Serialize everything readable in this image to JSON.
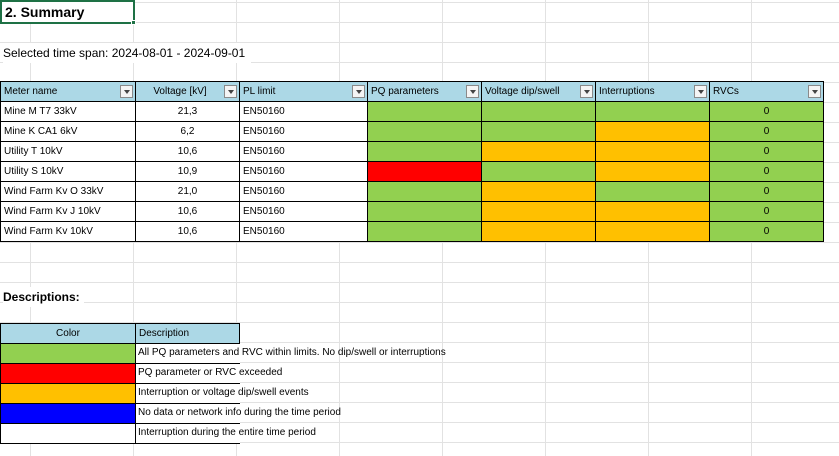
{
  "sheet": {
    "title": "2. Summary",
    "time_span": "Selected time span: 2024-08-01 - 2024-09-01",
    "descriptions_title": "Descriptions:"
  },
  "colors": {
    "green": "#92d050",
    "red": "#ff0000",
    "orange": "#ffc000",
    "blue": "#0000ff",
    "white": "#ffffff",
    "header": "#acd8e6"
  },
  "table": {
    "headers": [
      "Meter name",
      "Voltage [kV]",
      "PL limit",
      "PQ parameters",
      "Voltage dip/swell",
      "Interruptions",
      "RVCs"
    ],
    "rows": [
      {
        "meter": "Mine M T7 33kV",
        "voltage": "21,3",
        "pl_limit": "EN50160",
        "pq": "green",
        "dip": "green",
        "interruptions": "green",
        "rvcs": "0",
        "rvc_color": "green"
      },
      {
        "meter": "Mine K CA1 6kV",
        "voltage": "6,2",
        "pl_limit": "EN50160",
        "pq": "green",
        "dip": "green",
        "interruptions": "orange",
        "rvcs": "0",
        "rvc_color": "green"
      },
      {
        "meter": "Utility T 10kV",
        "voltage": "10,6",
        "pl_limit": "EN50160",
        "pq": "green",
        "dip": "orange",
        "interruptions": "orange",
        "rvcs": "0",
        "rvc_color": "green"
      },
      {
        "meter": "Utility S 10kV",
        "voltage": "10,9",
        "pl_limit": "EN50160",
        "pq": "red",
        "dip": "green",
        "interruptions": "orange",
        "rvcs": "0",
        "rvc_color": "green"
      },
      {
        "meter": "Wind Farm Kv O 33kV",
        "voltage": "21,0",
        "pl_limit": "EN50160",
        "pq": "green",
        "dip": "orange",
        "interruptions": "green",
        "rvcs": "0",
        "rvc_color": "green"
      },
      {
        "meter": "Wind Farm Kv J 10kV",
        "voltage": "10,6",
        "pl_limit": "EN50160",
        "pq": "green",
        "dip": "orange",
        "interruptions": "orange",
        "rvcs": "0",
        "rvc_color": "green"
      },
      {
        "meter": "Wind Farm Kv 10kV",
        "voltage": "10,6",
        "pl_limit": "EN50160",
        "pq": "green",
        "dip": "orange",
        "interruptions": "orange",
        "rvcs": "0",
        "rvc_color": "green"
      }
    ]
  },
  "legend": {
    "color_header": "Color",
    "description_header": "Description",
    "items": [
      {
        "color": "green",
        "text": "All PQ parameters and RVC within limits. No dip/swell or interruptions"
      },
      {
        "color": "red",
        "text": "PQ parameter or RVC exceeded"
      },
      {
        "color": "orange",
        "text": "Interruption or voltage dip/swell events"
      },
      {
        "color": "blue",
        "text": "No data or network info during the time period"
      },
      {
        "color": "white",
        "text": "Interruption during the entire time period"
      }
    ]
  }
}
